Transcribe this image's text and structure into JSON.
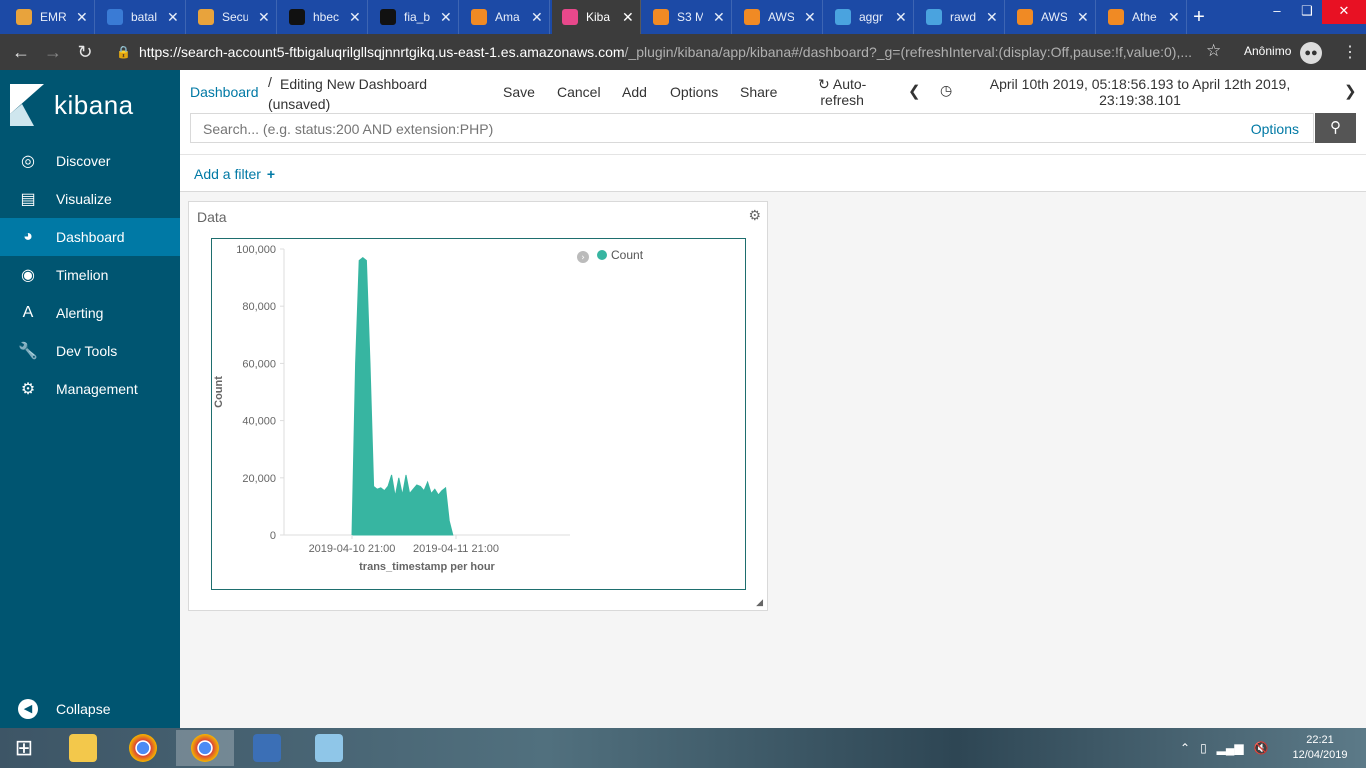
{
  "browser": {
    "tabs": [
      {
        "title": "EMR",
        "icon": "aws-icon",
        "color": "#e8a33c"
      },
      {
        "title": "batal",
        "icon": "feather-icon",
        "color": "#3a7bd5"
      },
      {
        "title": "Secu",
        "icon": "aws-icon",
        "color": "#e8a33c"
      },
      {
        "title": "hbec",
        "icon": "github-icon",
        "color": "#111111"
      },
      {
        "title": "fia_b",
        "icon": "github-icon",
        "color": "#111111"
      },
      {
        "title": "Ama",
        "icon": "aws-cube-icon",
        "color": "#f08a24"
      },
      {
        "title": "Kiba",
        "icon": "kibana-icon",
        "color": "#e8488b",
        "active": true
      },
      {
        "title": "S3 M",
        "icon": "aws-cube-icon",
        "color": "#f08a24"
      },
      {
        "title": "AWS",
        "icon": "aws-cube-icon",
        "color": "#f08a24"
      },
      {
        "title": "aggr",
        "icon": "chart-icon",
        "color": "#4aa3df"
      },
      {
        "title": "rawd",
        "icon": "chart-icon",
        "color": "#4aa3df"
      },
      {
        "title": "AWS",
        "icon": "aws-cube-icon",
        "color": "#f08a24"
      },
      {
        "title": "Athe",
        "icon": "aws-cube-icon",
        "color": "#f08a24"
      }
    ],
    "url_main": "https://search-account5-ftbigaluqrilgllsqjnnrtgikq.us-east-1.es.amazonaws.com",
    "url_rest": "/_plugin/kibana/app/kibana#/dashboard?_g=(refreshInterval:(display:Off,pause:!f,value:0),...",
    "profile_name": "Anônimo"
  },
  "sidebar": {
    "brand": "kibana",
    "items": [
      {
        "label": "Discover",
        "icon": "compass-icon"
      },
      {
        "label": "Visualize",
        "icon": "bar-chart-icon"
      },
      {
        "label": "Dashboard",
        "icon": "dashboard-icon",
        "active": true
      },
      {
        "label": "Timelion",
        "icon": "timelion-icon"
      },
      {
        "label": "Alerting",
        "icon": "alerting-icon"
      },
      {
        "label": "Dev Tools",
        "icon": "wrench-icon"
      },
      {
        "label": "Management",
        "icon": "gear-icon"
      }
    ],
    "collapse_label": "Collapse"
  },
  "topnav": {
    "breadcrumb_link": "Dashboard",
    "breadcrumb_separator": "/",
    "breadcrumb_current": "Editing New Dashboard (unsaved)",
    "actions": {
      "save": "Save",
      "cancel": "Cancel",
      "add": "Add",
      "options": "Options",
      "share": "Share"
    },
    "autorefresh_line1": "Auto-",
    "autorefresh_line2": "refresh",
    "time_range_line1": "April 10th 2019, 05:18:56.193 to April 12th 2019,",
    "time_range_line2": "23:19:38.101"
  },
  "search": {
    "placeholder": "Search... (e.g. status:200 AND extension:PHP)",
    "options_label": "Options"
  },
  "filters": {
    "add_filter_label": "Add a filter"
  },
  "panel": {
    "title": "Data"
  },
  "chart_data": {
    "type": "area",
    "ylabel": "Count",
    "xlabel": "trans_timestamp per hour",
    "ylim": [
      0,
      100000
    ],
    "yticks": [
      0,
      20000,
      40000,
      60000,
      80000,
      100000
    ],
    "ytick_labels": [
      "0",
      "20,000",
      "40,000",
      "60,000",
      "80,000",
      "100,000"
    ],
    "xtick_labels": [
      "2019-04-10 21:00",
      "2019-04-11 21:00"
    ],
    "legend": "top-right",
    "color": "#37b5a1",
    "series": [
      {
        "name": "Count",
        "x": [
          "2019-04-10 19:00",
          "2019-04-10 20:00",
          "2019-04-10 21:00",
          "2019-04-10 22:00",
          "2019-04-10 23:00",
          "2019-04-11 00:00",
          "2019-04-11 01:00",
          "2019-04-11 02:00",
          "2019-04-11 03:00",
          "2019-04-11 04:00",
          "2019-04-11 05:00",
          "2019-04-11 06:00",
          "2019-04-11 07:00",
          "2019-04-11 08:00",
          "2019-04-11 09:00",
          "2019-04-11 10:00",
          "2019-04-11 11:00",
          "2019-04-11 12:00",
          "2019-04-11 13:00",
          "2019-04-11 14:00",
          "2019-04-11 15:00",
          "2019-04-11 16:00",
          "2019-04-11 17:00",
          "2019-04-11 18:00",
          "2019-04-11 19:00",
          "2019-04-11 20:00",
          "2019-04-11 21:00",
          "2019-04-11 22:00",
          "2019-04-11 23:00"
        ],
        "values": [
          0,
          60000,
          96000,
          97000,
          96000,
          60000,
          17000,
          16000,
          16500,
          15500,
          17000,
          21000,
          13500,
          20000,
          14000,
          21000,
          14500,
          16000,
          17500,
          17000,
          15500,
          18500,
          14500,
          16000,
          14000,
          15500,
          16500,
          5000,
          0
        ]
      }
    ]
  },
  "taskbar": {
    "time": "22:21",
    "date": "12/04/2019"
  }
}
